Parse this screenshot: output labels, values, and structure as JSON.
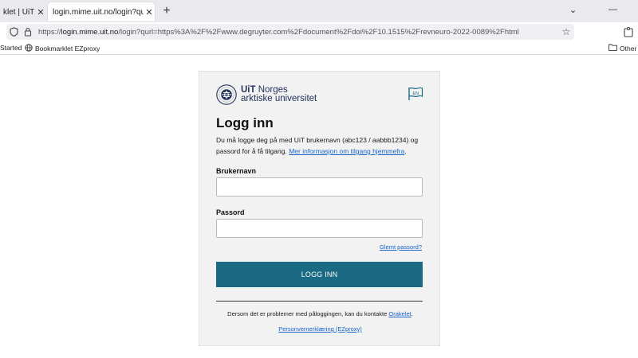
{
  "browser": {
    "tabs": [
      {
        "title": "klet | UiT",
        "close": "✕"
      },
      {
        "title": "login.mime.uit.no/login?qurl=https:",
        "close": "✕"
      }
    ],
    "new_tab": "+",
    "window_controls": {
      "chevron": "⌄",
      "minimize": "—"
    },
    "url": {
      "scheme": "https://",
      "host": "login.mime.uit.no",
      "path": "/login?qurl=https%3A%2F%2Fwww.degruyter.com%2Fdocument%2Fdoi%2F10.1515%2Frevneuro-2022-0089%2Fhtml"
    },
    "bookmarks": {
      "started": "Started",
      "ezproxy": "Bookmarklet EZproxy",
      "other": "Other B"
    }
  },
  "login": {
    "logo_line1_bold": "UiT",
    "logo_line1_rest": " Norges",
    "logo_line2": "arktiske universitet",
    "lang_button": "EN",
    "title": "Logg inn",
    "info_text": "Du må logge deg på med UiT brukernavn (abc123 / aabbb1234) og passord for å få tilgang. ",
    "info_link": "Mer informasjon om tilgang hjemmefra",
    "info_end": ".",
    "username_label": "Brukernavn",
    "username_value": "",
    "password_label": "Passord",
    "password_value": "",
    "forgot": "Glemt passord?",
    "submit": "LOGG INN",
    "problems_text": "Dersom det er problemer med påloggingen, kan du kontakte ",
    "problems_link": "Orakelet",
    "problems_end": ".",
    "privacy": "Personvernerklæring (EZproxy)"
  },
  "colors": {
    "accent": "#1b6a83",
    "link": "#1763c9",
    "card_bg": "#f2f2f2",
    "logo": "#22335a"
  },
  "icons": [
    "shield-icon",
    "lock-icon",
    "star-icon",
    "extension-icon",
    "globe-icon",
    "folder-icon",
    "uit-seal-logo",
    "flag-icon"
  ]
}
